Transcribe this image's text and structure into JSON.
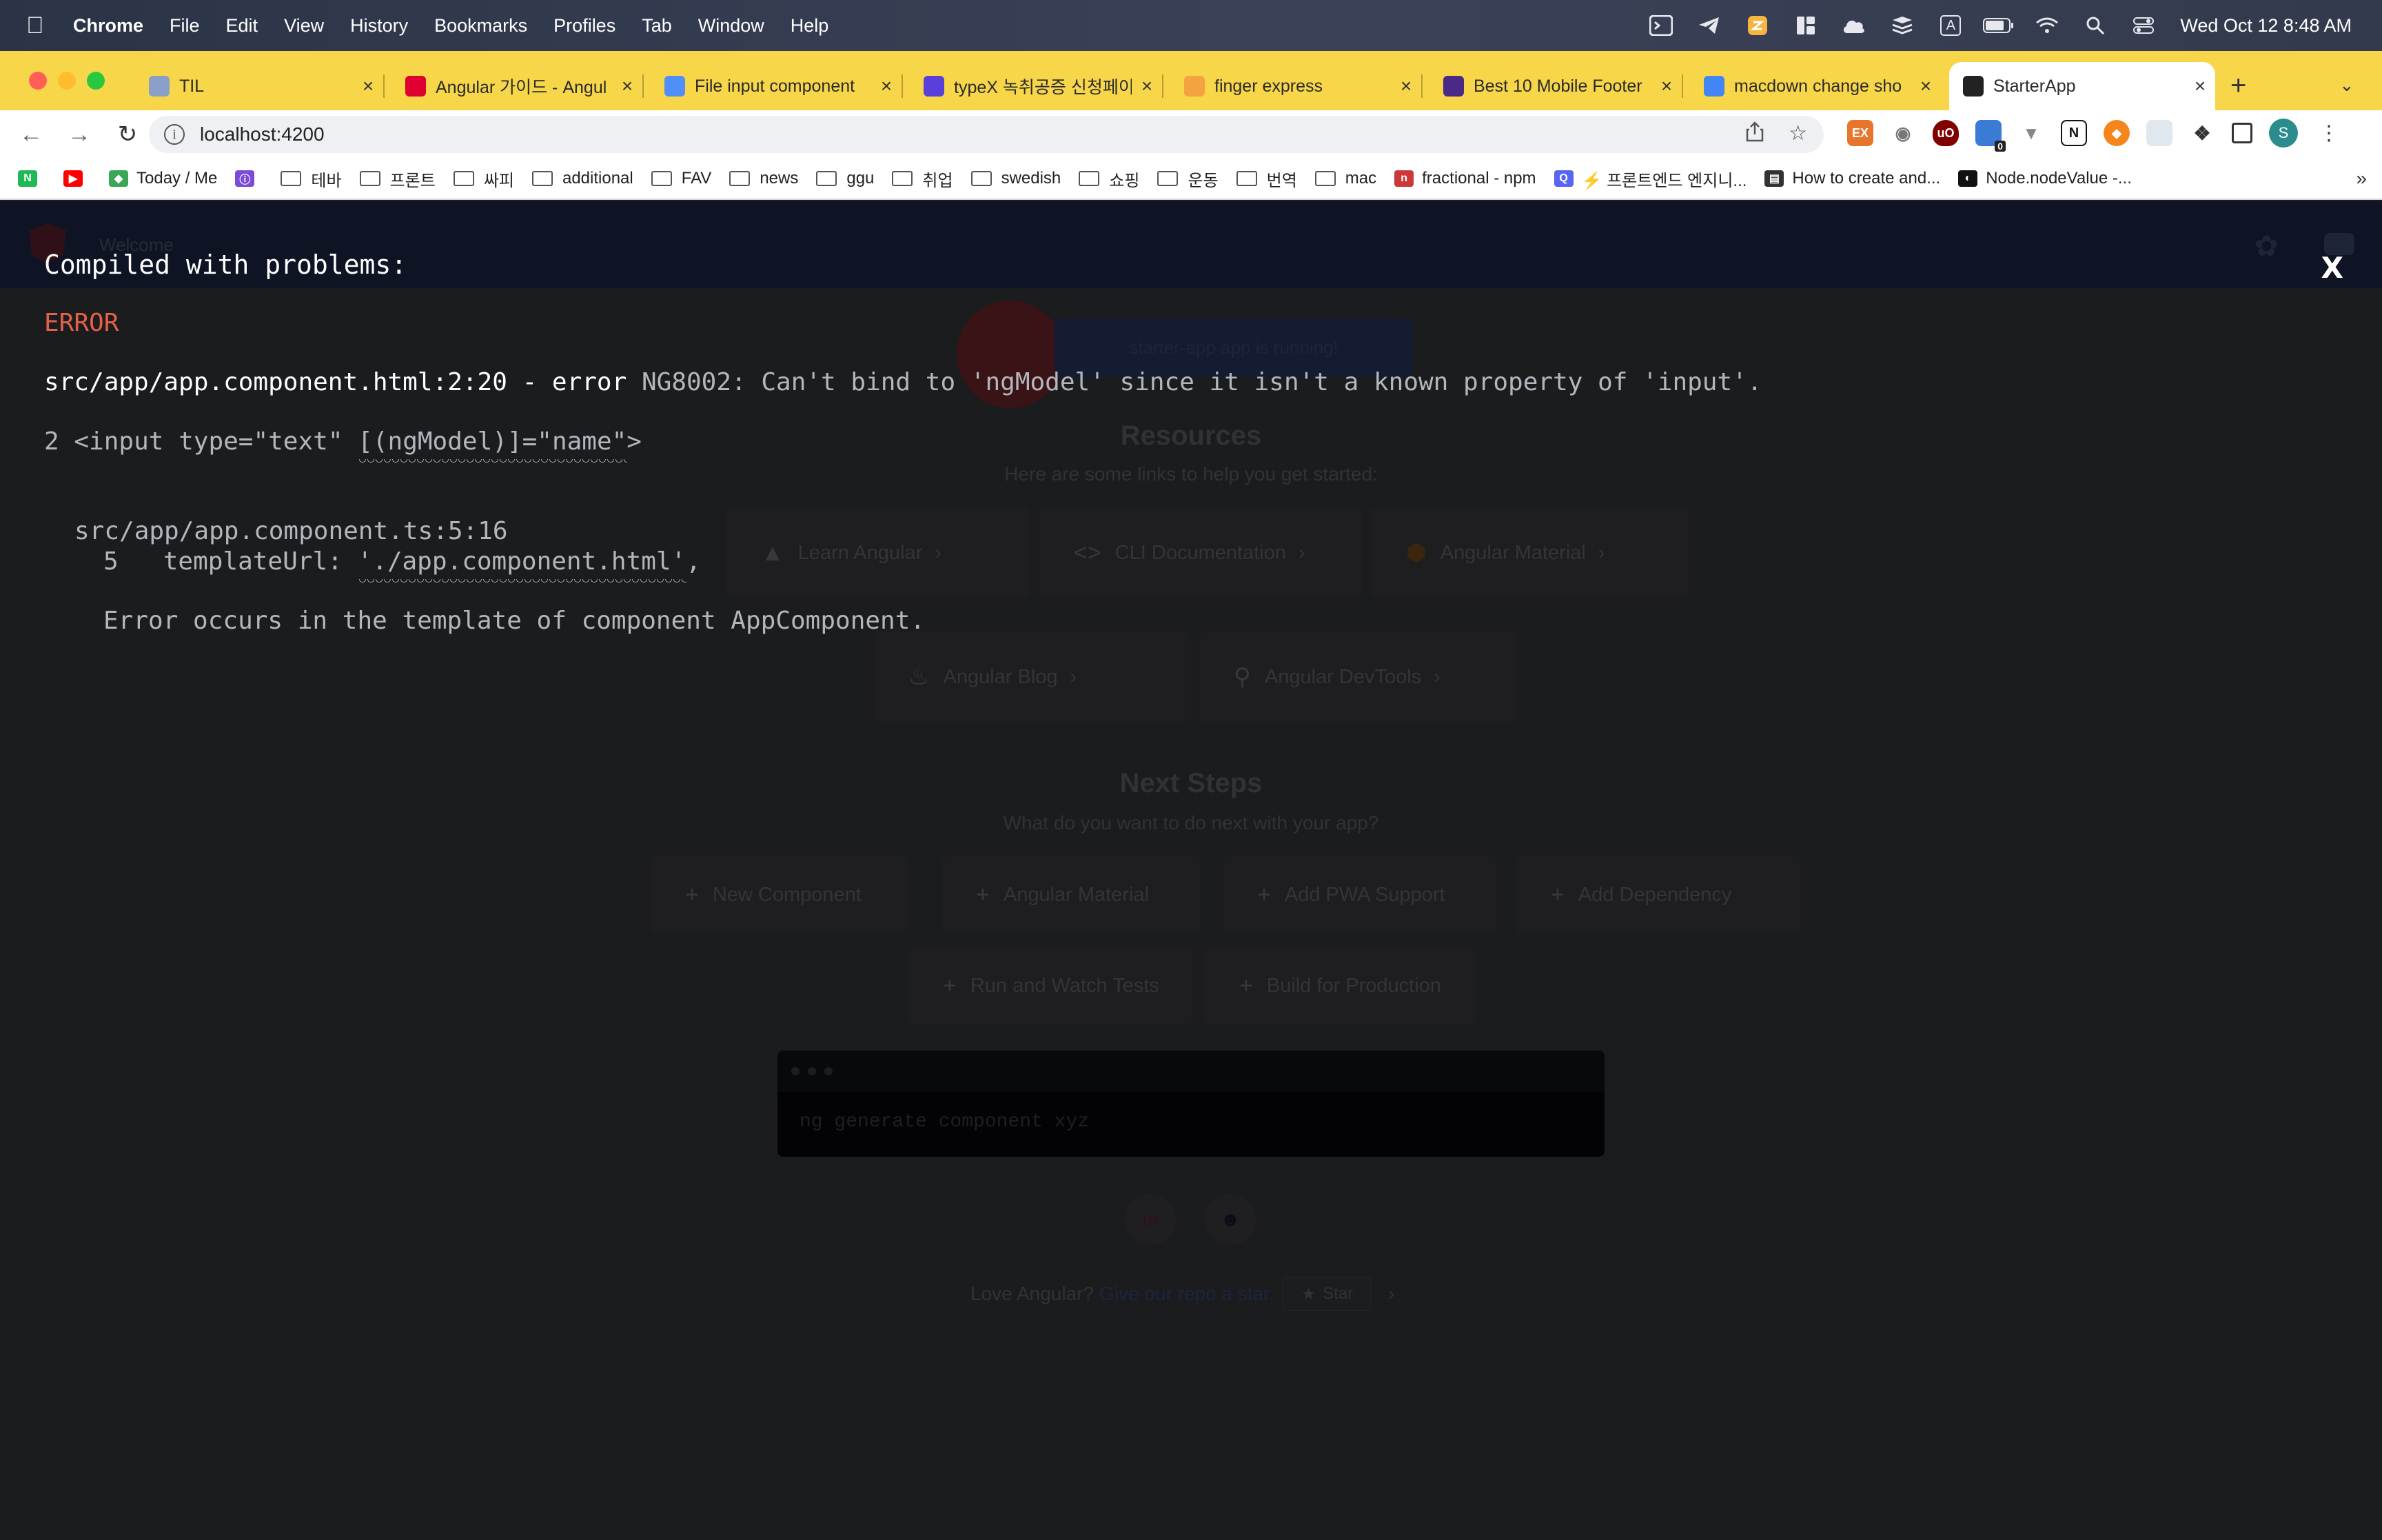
{
  "menubar": {
    "apple_icon": "apple-icon",
    "app_name": "Chrome",
    "items": [
      "File",
      "Edit",
      "View",
      "History",
      "Bookmarks",
      "Profiles",
      "Tab",
      "Window",
      "Help"
    ],
    "status_icons": [
      "terminal-icon",
      "telegram-icon",
      "shortcuts-icon",
      "layout-icon",
      "cloud-icon",
      "stack-icon",
      "input-source-icon",
      "battery-icon",
      "wifi-icon",
      "spotlight-icon",
      "control-center-icon"
    ],
    "input_source_label": "A",
    "clock": "Wed Oct 12  8:48 AM"
  },
  "tabs": [
    {
      "label": "TIL",
      "favicon_color": "#8aa0c8",
      "active": false
    },
    {
      "label": "Angular 가이드 - Angul",
      "favicon_color": "#dd0031",
      "active": false
    },
    {
      "label": "File input component",
      "favicon_color": "#4f8ff7",
      "active": false
    },
    {
      "label": "typeX 녹취공증 신청페이",
      "favicon_color": "#5b3fd9",
      "active": false
    },
    {
      "label": "finger express",
      "favicon_color": "#f4a340",
      "active": false
    },
    {
      "label": "Best 10 Mobile Footer",
      "favicon_color": "#4b2a86",
      "active": false
    },
    {
      "label": "macdown change sho",
      "favicon_color": "#4285f4",
      "active": false
    },
    {
      "label": "StarterApp",
      "favicon_color": "#222222",
      "active": true
    }
  ],
  "toolbar": {
    "back_icon": "back-arrow-icon",
    "forward_icon": "forward-arrow-icon",
    "reload_icon": "reload-icon",
    "url": "localhost:4200",
    "extension_badge": "0",
    "profile_initial": "S"
  },
  "bookmarks": [
    {
      "label": "",
      "type": "icon",
      "color": "#1fb956",
      "glyph": "N"
    },
    {
      "label": "",
      "type": "icon",
      "color": "#ff0000",
      "glyph": "▶"
    },
    {
      "label": "Today / Me",
      "type": "icon",
      "color": "#3aa757",
      "glyph": "◆"
    },
    {
      "label": "",
      "type": "icon",
      "color": "#7b4bd8",
      "glyph": "ⓘ"
    },
    {
      "label": "테바",
      "type": "folder"
    },
    {
      "label": "프론트",
      "type": "folder"
    },
    {
      "label": "싸피",
      "type": "folder"
    },
    {
      "label": "additional",
      "type": "folder"
    },
    {
      "label": "FAV",
      "type": "folder"
    },
    {
      "label": "news",
      "type": "folder"
    },
    {
      "label": "ggu",
      "type": "folder"
    },
    {
      "label": "취업",
      "type": "folder"
    },
    {
      "label": "swedish",
      "type": "folder"
    },
    {
      "label": "쇼핑",
      "type": "folder"
    },
    {
      "label": "운동",
      "type": "folder"
    },
    {
      "label": "번역",
      "type": "folder"
    },
    {
      "label": "mac",
      "type": "folder"
    },
    {
      "label": "fractional - npm",
      "type": "icon",
      "color": "#cb3837",
      "glyph": "n"
    },
    {
      "label": "⚡ 프론트엔드 엔지니...",
      "type": "icon",
      "color": "#5865f2",
      "glyph": "Q"
    },
    {
      "label": "How to create and...",
      "type": "icon",
      "color": "#333333",
      "glyph": "▤"
    },
    {
      "label": "Node.nodeValue -...",
      "type": "icon",
      "color": "#111111",
      "glyph": "◐"
    }
  ],
  "bookmarks_more": "»",
  "page": {
    "welcome": "Welcome",
    "running": "starter-app app is running!",
    "resources_title": "Resources",
    "resources_sub": "Here are some links to help you get started:",
    "resource_cards": [
      "Learn Angular",
      "CLI Documentation",
      "Angular Material",
      "Angular Blog",
      "Angular DevTools"
    ],
    "next_title": "Next Steps",
    "next_sub": "What do you want to do next with your app?",
    "next_cards": [
      "New Component",
      "Angular Material",
      "Add PWA Support",
      "Add Dependency",
      "Run and Watch Tests",
      "Build for Production"
    ],
    "terminal_cmd": "ng generate component xyz",
    "love_text": "Love Angular?",
    "love_link": "Give our repo a star.",
    "star_label": "Star"
  },
  "overlay": {
    "title": "Compiled with problems:",
    "close": "X",
    "error_label": "ERROR",
    "error_location": "src/app/app.component.html:2:20 - error",
    "error_message": "NG8002: Can't bind to 'ngModel' since it isn't a known property of 'input'.",
    "code_line_number": "2",
    "code_line": "<input type=\"text\" [(ngModel)]=\"name\">",
    "ts_location": "src/app/app.component.ts:5:16",
    "ts_line_number": "5",
    "ts_line": "templateUrl: './app.component.html',",
    "component_note": "Error occurs in the template of component AppComponent."
  }
}
